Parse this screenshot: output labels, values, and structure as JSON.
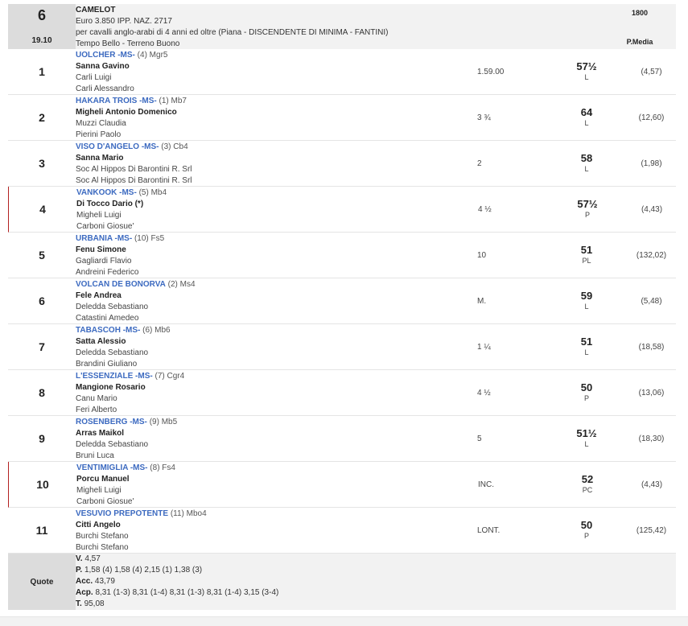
{
  "race": {
    "number": "6",
    "time": "19.10",
    "name": "CAMELOT",
    "prize": "Euro 3.850 IPP. NAZ. 2717",
    "conditions": "per cavalli anglo-arabi di 4 anni ed oltre (Piana -  DISCENDENTE DI MINIMA  - FANTINI)",
    "weather": "Tempo Bello - Terreno Buono",
    "distance": "1800",
    "col_label": "P.Media"
  },
  "results": [
    {
      "pos": "1",
      "horse": "UOLCHER -MS-",
      "extra": "(4) Mgr5",
      "jockey": "Sanna Gavino",
      "trainer": "Carli Luigi",
      "owner": "Carli Alessandro",
      "dist": "1.59.00",
      "weight": "57½",
      "status": "L",
      "odds": "(4,57)",
      "flag": false
    },
    {
      "pos": "2",
      "horse": "HAKARA TROIS -MS-",
      "extra": "(1) Mb7",
      "jockey": "Migheli Antonio Domenico",
      "trainer": "Muzzi Claudia",
      "owner": "Pierini Paolo",
      "dist": "3 ¾",
      "weight": "64",
      "status": "L",
      "odds": "(12,60)",
      "flag": false
    },
    {
      "pos": "3",
      "horse": "VISO D'ANGELO -MS-",
      "extra": "(3) Cb4",
      "jockey": "Sanna Mario",
      "trainer": "Soc Al Hippos Di Barontini R. Srl",
      "owner": "Soc Al Hippos Di Barontini R. Srl",
      "dist": "2",
      "weight": "58",
      "status": "L",
      "odds": "(1,98)",
      "flag": false
    },
    {
      "pos": "4",
      "horse": "VANKOOK -MS-",
      "extra": "(5) Mb4",
      "jockey": "Di Tocco Dario (*)",
      "trainer": "Migheli Luigi",
      "owner": "Carboni Giosue'",
      "dist": "4 ½",
      "weight": "57½",
      "status": "P",
      "odds": "(4,43)",
      "flag": true
    },
    {
      "pos": "5",
      "horse": "URBANIA -MS-",
      "extra": "(10) Fs5",
      "jockey": "Fenu Simone",
      "trainer": "Gagliardi Flavio",
      "owner": "Andreini Federico",
      "dist": "10",
      "weight": "51",
      "status": "PL",
      "odds": "(132,02)",
      "flag": false
    },
    {
      "pos": "6",
      "horse": "VOLCAN DE BONORVA",
      "extra": "(2) Ms4",
      "jockey": "Fele Andrea",
      "trainer": "Deledda Sebastiano",
      "owner": "Catastini Amedeo",
      "dist": "M.",
      "weight": "59",
      "status": "L",
      "odds": "(5,48)",
      "flag": false
    },
    {
      "pos": "7",
      "horse": "TABASCOH -MS-",
      "extra": "(6) Mb6",
      "jockey": "Satta Alessio",
      "trainer": "Deledda Sebastiano",
      "owner": "Brandini Giuliano",
      "dist": "1 ¼",
      "weight": "51",
      "status": "L",
      "odds": "(18,58)",
      "flag": false
    },
    {
      "pos": "8",
      "horse": "L'ESSENZIALE -MS-",
      "extra": "(7) Cgr4",
      "jockey": "Mangione Rosario",
      "trainer": "Canu Mario",
      "owner": "Feri Alberto",
      "dist": "4 ½",
      "weight": "50",
      "status": "P",
      "odds": "(13,06)",
      "flag": false
    },
    {
      "pos": "9",
      "horse": "ROSENBERG -MS-",
      "extra": "(9) Mb5",
      "jockey": "Arras Maikol",
      "trainer": "Deledda Sebastiano",
      "owner": "Bruni Luca",
      "dist": "5",
      "weight": "51½",
      "status": "L",
      "odds": "(18,30)",
      "flag": false
    },
    {
      "pos": "10",
      "horse": "VENTIMIGLIA -MS-",
      "extra": "(8) Fs4",
      "jockey": "Porcu Manuel",
      "trainer": "Migheli Luigi",
      "owner": "Carboni Giosue'",
      "dist": "INC.",
      "weight": "52",
      "status": "PC",
      "odds": "(4,43)",
      "flag": true
    },
    {
      "pos": "11",
      "horse": "VESUVIO PREPOTENTE",
      "extra": "(11) Mbo4",
      "jockey": "Citti Angelo",
      "trainer": "Burchi Stefano",
      "owner": "Burchi Stefano",
      "dist": "LONT.",
      "weight": "50",
      "status": "P",
      "odds": "(125,42)",
      "flag": false
    }
  ],
  "quote": {
    "label": "Quote",
    "lines": [
      {
        "key": "V.",
        "value": "4,57"
      },
      {
        "key": "P.",
        "value": "1,58 (4)  1,58 (4)  2,15 (1)  1,38 (3)"
      },
      {
        "key": "Acc.",
        "value": "43,79"
      },
      {
        "key": "Acp.",
        "value": "8,31 (1-3)  8,31 (1-4)  8,31 (1-3)  8,31 (1-4)  3,15 (3-4)"
      },
      {
        "key": "T.",
        "value": "95,08"
      }
    ]
  }
}
